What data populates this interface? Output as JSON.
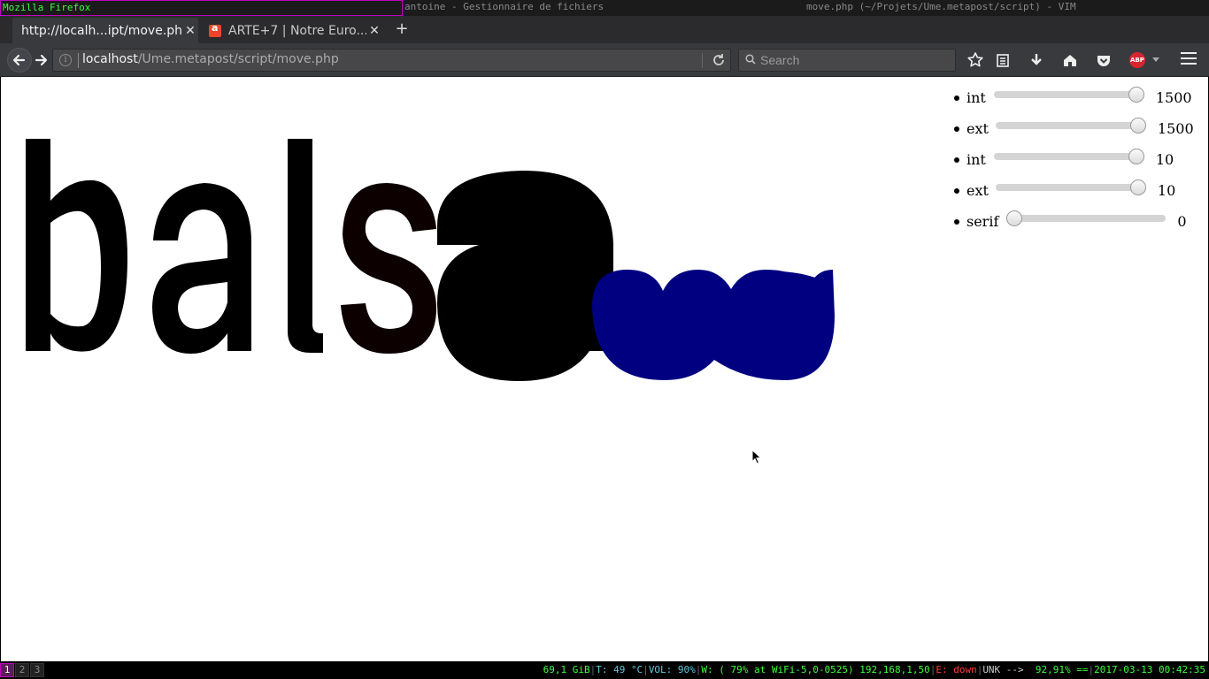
{
  "wm": {
    "titles": [
      "Mozilla Firefox",
      "antoine - Gestionnaire de fichiers",
      "move.php (~/Projets/Ume.metapost/script) - VIM"
    ]
  },
  "browser": {
    "tabs": [
      {
        "label": "http://localh...ipt/move.php",
        "active": true
      },
      {
        "label": "ARTE+7 | Notre Euro...",
        "active": false
      }
    ],
    "url_host": "localhost",
    "url_path": "/Ume.metapost/script/move.php",
    "search_placeholder": "Search",
    "colors": {
      "chrome": "#393a3e",
      "tabbar": "#2b2b2d",
      "abp": "#d8262e"
    }
  },
  "page": {
    "glyph_text": [
      "b",
      "a",
      "l",
      "s"
    ],
    "colors": {
      "glyph": "#000000",
      "blue_shape": "#000080",
      "s_glyph": "#0c0000"
    },
    "controls": [
      {
        "label": "int",
        "value": "1500",
        "fraction": 1.0
      },
      {
        "label": "ext",
        "value": "1500",
        "fraction": 1.0
      },
      {
        "label": "int",
        "value": "10",
        "fraction": 1.0
      },
      {
        "label": "ext",
        "value": "10",
        "fraction": 1.0
      },
      {
        "label": "serif",
        "value": "0",
        "fraction": 0.0
      }
    ]
  },
  "statusbar": {
    "workspaces": [
      "1",
      "2",
      "3"
    ],
    "disk": "69,1 GiB",
    "temp": "T: 49 °C",
    "vol": "VOL: 90%",
    "wifi": "W: ( 79% at WiFi-5,0-0525) 192,168,1,50",
    "eth": "E: down",
    "unk": "UNK -->",
    "battery": "92,91% ==",
    "datetime": "2017-03-13 00:42:35"
  }
}
